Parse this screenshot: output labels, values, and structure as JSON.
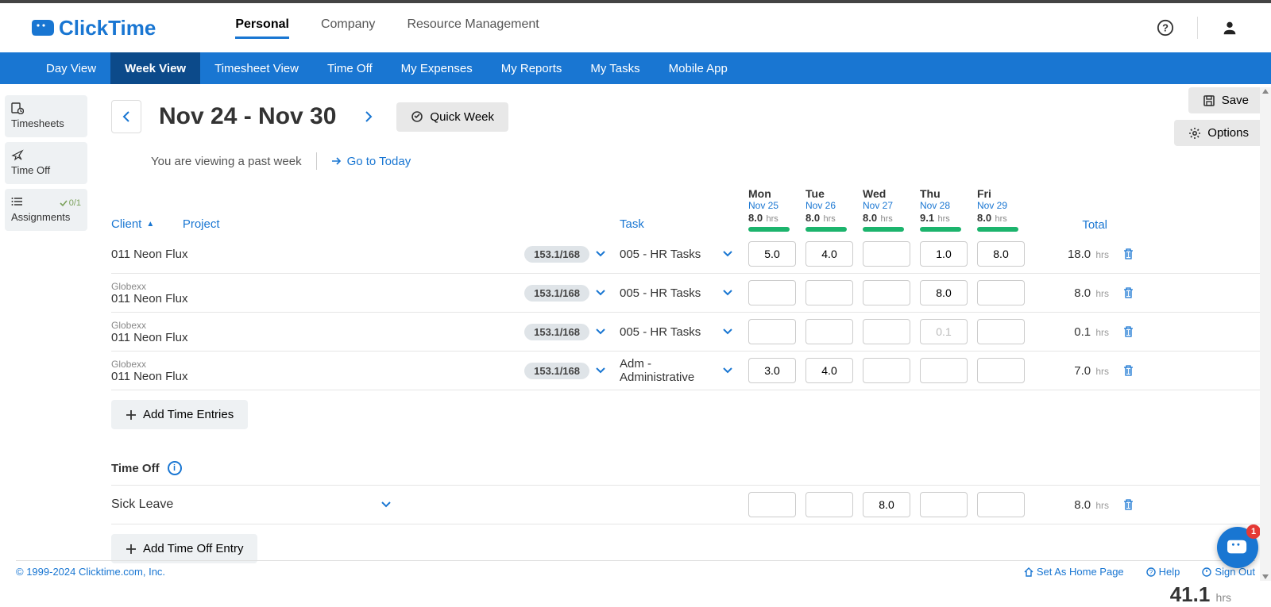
{
  "brand": "ClickTime",
  "primary_tabs": {
    "personal": "Personal",
    "company": "Company",
    "resource": "Resource Management"
  },
  "sub_nav": {
    "day": "Day View",
    "week": "Week View",
    "timesheet": "Timesheet View",
    "timeoff": "Time Off",
    "expenses": "My Expenses",
    "reports": "My Reports",
    "tasks": "My Tasks",
    "mobile": "Mobile App"
  },
  "sidebar": {
    "timesheets": "Timesheets",
    "timeoff": "Time Off",
    "assignments": "Assignments",
    "assign_badge": "0/1"
  },
  "week": {
    "title": "Nov 24 - Nov 30",
    "quick_week": "Quick Week",
    "save": "Save",
    "options": "Options",
    "past_msg": "You are viewing a past week",
    "go_today": "Go to Today"
  },
  "columns": {
    "client": "Client",
    "project": "Project",
    "task": "Task",
    "total": "Total"
  },
  "days": [
    {
      "name": "Mon",
      "date": "Nov 25",
      "hours": "8.0"
    },
    {
      "name": "Tue",
      "date": "Nov 26",
      "hours": "8.0"
    },
    {
      "name": "Wed",
      "date": "Nov 27",
      "hours": "8.0"
    },
    {
      "name": "Thu",
      "date": "Nov 28",
      "hours": "9.1"
    },
    {
      "name": "Fri",
      "date": "Nov 29",
      "hours": "8.0"
    }
  ],
  "hrs_label": "hrs",
  "entries": [
    {
      "client": "",
      "project": "011 Neon Flux",
      "pill": "153.1/168",
      "task": "005 - HR Tasks",
      "cells": [
        "5.0",
        "4.0",
        "",
        "1.0",
        "8.0"
      ],
      "total": "18.0"
    },
    {
      "client": "Globexx",
      "project": "011 Neon Flux",
      "pill": "153.1/168",
      "task": "005 - HR Tasks",
      "cells": [
        "",
        "",
        "",
        "8.0",
        ""
      ],
      "total": "8.0"
    },
    {
      "client": "Globexx",
      "project": "011 Neon Flux",
      "pill": "153.1/168",
      "task": "005 - HR Tasks",
      "cells": [
        "",
        "",
        "",
        "",
        ""
      ],
      "placeholder4": "0.1",
      "total": "0.1"
    },
    {
      "client": "Globexx",
      "project": "011 Neon Flux",
      "pill": "153.1/168",
      "task": "Adm - Administrative",
      "cells": [
        "3.0",
        "4.0",
        "",
        "",
        ""
      ],
      "total": "7.0"
    }
  ],
  "add_entries": "Add Time Entries",
  "timeoff_section": "Time Off",
  "timeoff_row": {
    "name": "Sick Leave",
    "cells": [
      "",
      "",
      "8.0",
      "",
      ""
    ],
    "total": "8.0"
  },
  "add_timeoff": "Add Time Off Entry",
  "grand_total": "41.1",
  "footer": {
    "copyright": "© 1999-2024 Clicktime.com, Inc.",
    "home": "Set As Home Page",
    "help": "Help",
    "signout": "Sign Out"
  },
  "chat_badge": "1"
}
